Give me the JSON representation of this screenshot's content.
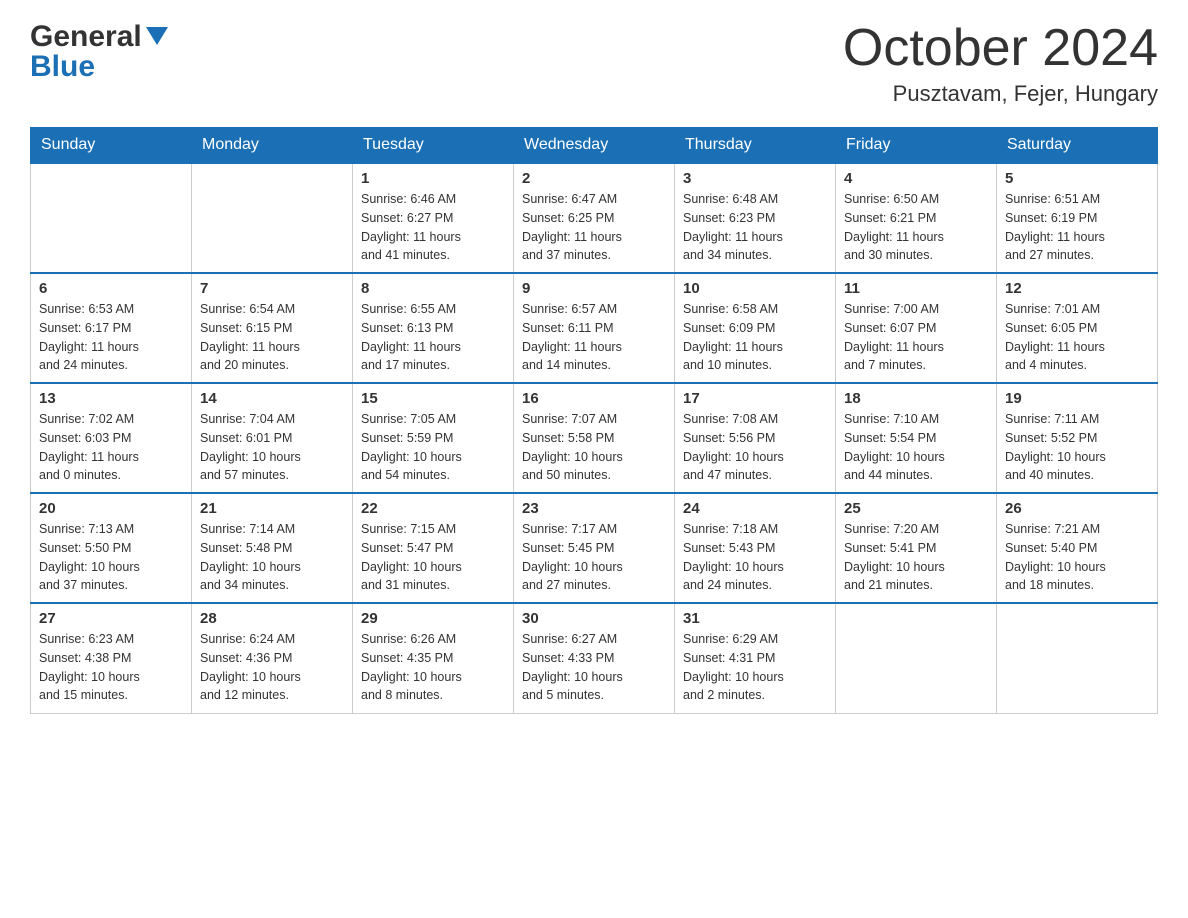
{
  "header": {
    "logo_line1": "General",
    "logo_line2": "Blue",
    "month": "October 2024",
    "location": "Pusztavam, Fejer, Hungary"
  },
  "days_of_week": [
    "Sunday",
    "Monday",
    "Tuesday",
    "Wednesday",
    "Thursday",
    "Friday",
    "Saturday"
  ],
  "weeks": [
    [
      {
        "num": "",
        "info": ""
      },
      {
        "num": "",
        "info": ""
      },
      {
        "num": "1",
        "info": "Sunrise: 6:46 AM\nSunset: 6:27 PM\nDaylight: 11 hours\nand 41 minutes."
      },
      {
        "num": "2",
        "info": "Sunrise: 6:47 AM\nSunset: 6:25 PM\nDaylight: 11 hours\nand 37 minutes."
      },
      {
        "num": "3",
        "info": "Sunrise: 6:48 AM\nSunset: 6:23 PM\nDaylight: 11 hours\nand 34 minutes."
      },
      {
        "num": "4",
        "info": "Sunrise: 6:50 AM\nSunset: 6:21 PM\nDaylight: 11 hours\nand 30 minutes."
      },
      {
        "num": "5",
        "info": "Sunrise: 6:51 AM\nSunset: 6:19 PM\nDaylight: 11 hours\nand 27 minutes."
      }
    ],
    [
      {
        "num": "6",
        "info": "Sunrise: 6:53 AM\nSunset: 6:17 PM\nDaylight: 11 hours\nand 24 minutes."
      },
      {
        "num": "7",
        "info": "Sunrise: 6:54 AM\nSunset: 6:15 PM\nDaylight: 11 hours\nand 20 minutes."
      },
      {
        "num": "8",
        "info": "Sunrise: 6:55 AM\nSunset: 6:13 PM\nDaylight: 11 hours\nand 17 minutes."
      },
      {
        "num": "9",
        "info": "Sunrise: 6:57 AM\nSunset: 6:11 PM\nDaylight: 11 hours\nand 14 minutes."
      },
      {
        "num": "10",
        "info": "Sunrise: 6:58 AM\nSunset: 6:09 PM\nDaylight: 11 hours\nand 10 minutes."
      },
      {
        "num": "11",
        "info": "Sunrise: 7:00 AM\nSunset: 6:07 PM\nDaylight: 11 hours\nand 7 minutes."
      },
      {
        "num": "12",
        "info": "Sunrise: 7:01 AM\nSunset: 6:05 PM\nDaylight: 11 hours\nand 4 minutes."
      }
    ],
    [
      {
        "num": "13",
        "info": "Sunrise: 7:02 AM\nSunset: 6:03 PM\nDaylight: 11 hours\nand 0 minutes."
      },
      {
        "num": "14",
        "info": "Sunrise: 7:04 AM\nSunset: 6:01 PM\nDaylight: 10 hours\nand 57 minutes."
      },
      {
        "num": "15",
        "info": "Sunrise: 7:05 AM\nSunset: 5:59 PM\nDaylight: 10 hours\nand 54 minutes."
      },
      {
        "num": "16",
        "info": "Sunrise: 7:07 AM\nSunset: 5:58 PM\nDaylight: 10 hours\nand 50 minutes."
      },
      {
        "num": "17",
        "info": "Sunrise: 7:08 AM\nSunset: 5:56 PM\nDaylight: 10 hours\nand 47 minutes."
      },
      {
        "num": "18",
        "info": "Sunrise: 7:10 AM\nSunset: 5:54 PM\nDaylight: 10 hours\nand 44 minutes."
      },
      {
        "num": "19",
        "info": "Sunrise: 7:11 AM\nSunset: 5:52 PM\nDaylight: 10 hours\nand 40 minutes."
      }
    ],
    [
      {
        "num": "20",
        "info": "Sunrise: 7:13 AM\nSunset: 5:50 PM\nDaylight: 10 hours\nand 37 minutes."
      },
      {
        "num": "21",
        "info": "Sunrise: 7:14 AM\nSunset: 5:48 PM\nDaylight: 10 hours\nand 34 minutes."
      },
      {
        "num": "22",
        "info": "Sunrise: 7:15 AM\nSunset: 5:47 PM\nDaylight: 10 hours\nand 31 minutes."
      },
      {
        "num": "23",
        "info": "Sunrise: 7:17 AM\nSunset: 5:45 PM\nDaylight: 10 hours\nand 27 minutes."
      },
      {
        "num": "24",
        "info": "Sunrise: 7:18 AM\nSunset: 5:43 PM\nDaylight: 10 hours\nand 24 minutes."
      },
      {
        "num": "25",
        "info": "Sunrise: 7:20 AM\nSunset: 5:41 PM\nDaylight: 10 hours\nand 21 minutes."
      },
      {
        "num": "26",
        "info": "Sunrise: 7:21 AM\nSunset: 5:40 PM\nDaylight: 10 hours\nand 18 minutes."
      }
    ],
    [
      {
        "num": "27",
        "info": "Sunrise: 6:23 AM\nSunset: 4:38 PM\nDaylight: 10 hours\nand 15 minutes."
      },
      {
        "num": "28",
        "info": "Sunrise: 6:24 AM\nSunset: 4:36 PM\nDaylight: 10 hours\nand 12 minutes."
      },
      {
        "num": "29",
        "info": "Sunrise: 6:26 AM\nSunset: 4:35 PM\nDaylight: 10 hours\nand 8 minutes."
      },
      {
        "num": "30",
        "info": "Sunrise: 6:27 AM\nSunset: 4:33 PM\nDaylight: 10 hours\nand 5 minutes."
      },
      {
        "num": "31",
        "info": "Sunrise: 6:29 AM\nSunset: 4:31 PM\nDaylight: 10 hours\nand 2 minutes."
      },
      {
        "num": "",
        "info": ""
      },
      {
        "num": "",
        "info": ""
      }
    ]
  ]
}
